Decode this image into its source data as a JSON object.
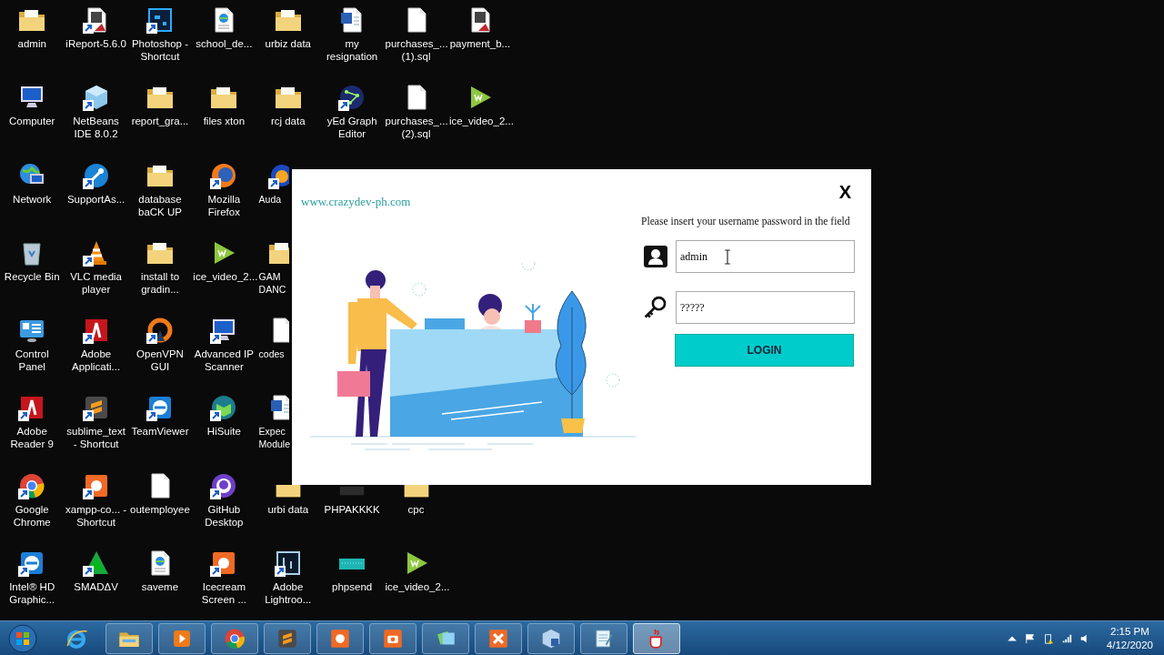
{
  "desktop_columns": [
    {
      "top": [
        {
          "label": "admin",
          "kind": "folder",
          "shortcut": false
        },
        {
          "label": "Computer",
          "kind": "computer",
          "shortcut": false
        },
        {
          "label": "Network",
          "kind": "network",
          "shortcut": false
        },
        {
          "label": "Recycle Bin",
          "kind": "recycle",
          "shortcut": false
        },
        {
          "label": "Control Panel",
          "kind": "control-panel",
          "shortcut": false
        },
        {
          "label": "Adobe Reader 9",
          "kind": "red-tile",
          "shortcut": true
        },
        {
          "label": "Google Chrome",
          "kind": "chrome",
          "shortcut": true
        },
        {
          "label": "Intel® HD Graphic...",
          "kind": "blue-tile",
          "shortcut": true
        }
      ]
    },
    {
      "top": [
        {
          "label": "iReport-5.6.0",
          "kind": "report",
          "shortcut": true
        },
        {
          "label": "NetBeans IDE 8.0.2",
          "kind": "cube",
          "shortcut": true
        },
        {
          "label": "SupportAs...",
          "kind": "support",
          "shortcut": true
        },
        {
          "label": "VLC media player",
          "kind": "cone",
          "shortcut": true
        },
        {
          "label": "Adobe Applicati...",
          "kind": "red-tile",
          "shortcut": true
        },
        {
          "label": "sublime_text - Shortcut",
          "kind": "sublime",
          "shortcut": true
        },
        {
          "label": "xampp-co... - Shortcut",
          "kind": "orange-tile",
          "shortcut": true
        },
        {
          "label": "SMADΔV",
          "kind": "smadav",
          "shortcut": true
        }
      ]
    },
    {
      "top": [
        {
          "label": "Photoshop - Shortcut",
          "kind": "photoshop",
          "shortcut": true
        },
        {
          "label": "report_gra...",
          "kind": "folder",
          "shortcut": false
        },
        {
          "label": "database baCK UP",
          "kind": "folder",
          "shortcut": false
        },
        {
          "label": "install to gradin...",
          "kind": "folder",
          "shortcut": false
        },
        {
          "label": "OpenVPN GUI",
          "kind": "ring",
          "shortcut": true
        },
        {
          "label": "TeamViewer",
          "kind": "blue-tile",
          "shortcut": true
        },
        {
          "label": "outemployee",
          "kind": "file",
          "shortcut": false
        },
        {
          "label": "saveme",
          "kind": "web-file",
          "shortcut": false
        }
      ]
    },
    {
      "top": [
        {
          "label": "school_de...",
          "kind": "web-file",
          "shortcut": false
        },
        {
          "label": "files xton",
          "kind": "folder",
          "shortcut": false
        },
        {
          "label": "Mozilla Firefox",
          "kind": "firefox",
          "shortcut": true
        },
        {
          "label": "ice_video_2...",
          "kind": "play-green",
          "shortcut": false
        },
        {
          "label": "Advanced IP Scanner",
          "kind": "computer",
          "shortcut": true
        },
        {
          "label": "HiSuite",
          "kind": "green-cube",
          "shortcut": true
        },
        {
          "label": "GitHub Desktop",
          "kind": "purple-circle",
          "shortcut": true
        },
        {
          "label": "Icecream Screen ...",
          "kind": "orange-tile",
          "shortcut": true
        }
      ]
    },
    {
      "top": [
        {
          "label": "urbiz data",
          "kind": "folder",
          "shortcut": false
        },
        {
          "label": "rcj data",
          "kind": "folder",
          "shortcut": false
        },
        {
          "label": "Auda",
          "kind": "audio",
          "shortcut": true
        },
        {
          "label": "GAM DANC",
          "kind": "folder",
          "shortcut": false
        },
        {
          "label": "codes",
          "kind": "file",
          "shortcut": false
        },
        {
          "label": "Expec Module",
          "kind": "word",
          "shortcut": false
        },
        {
          "label": "urbi data",
          "kind": "folder",
          "shortcut": false
        },
        {
          "label": "Adobe Lightroo...",
          "kind": "dark-frame",
          "shortcut": true
        }
      ]
    },
    {
      "top": [
        {
          "label": "my resignation",
          "kind": "word",
          "shortcut": false
        },
        {
          "label": "yEd Graph Editor",
          "kind": "graph",
          "shortcut": true
        }
      ],
      "bottom": [
        {
          "label": "PHPAKKKK",
          "kind": "dark-bar",
          "shortcut": false
        },
        {
          "label": "phpsend",
          "kind": "teal-bar",
          "shortcut": false
        }
      ]
    },
    {
      "top": [
        {
          "label": "purchases_... (1).sql",
          "kind": "file",
          "shortcut": false
        },
        {
          "label": "purchases_... (2).sql",
          "kind": "file",
          "shortcut": false
        }
      ],
      "bottom": [
        {
          "label": "cpc",
          "kind": "folder",
          "shortcut": false
        },
        {
          "label": "ice_video_2...",
          "kind": "play-green",
          "shortcut": false
        }
      ]
    },
    {
      "top": [
        {
          "label": "payment_b...",
          "kind": "report",
          "shortcut": false
        },
        {
          "label": "ice_video_2...",
          "kind": "play-green",
          "shortcut": false
        }
      ]
    }
  ],
  "login_window": {
    "site_link": "www.crazydev-ph.com",
    "close": "X",
    "instruction": "Please insert your username password in the field",
    "username": {
      "value": "admin"
    },
    "password": {
      "value": "?????"
    },
    "login_button": "LOGIN"
  },
  "taskbar": {
    "items": [
      {
        "kind": "ie",
        "running": false,
        "selected": false
      },
      {
        "kind": "explorer",
        "running": true,
        "selected": false
      },
      {
        "kind": "media",
        "running": true,
        "selected": false
      },
      {
        "kind": "chrome",
        "running": true,
        "selected": false
      },
      {
        "kind": "sublime",
        "running": true,
        "selected": false
      },
      {
        "kind": "orange-tile",
        "running": true,
        "selected": false
      },
      {
        "kind": "camera",
        "running": true,
        "selected": false
      },
      {
        "kind": "files",
        "running": true,
        "selected": false
      },
      {
        "kind": "xampp",
        "running": true,
        "selected": false
      },
      {
        "kind": "virtualbox",
        "running": true,
        "selected": false
      },
      {
        "kind": "notepad",
        "running": true,
        "selected": false
      },
      {
        "kind": "java",
        "running": true,
        "selected": true
      }
    ],
    "time": "2:15 PM",
    "date": "4/12/2020"
  }
}
